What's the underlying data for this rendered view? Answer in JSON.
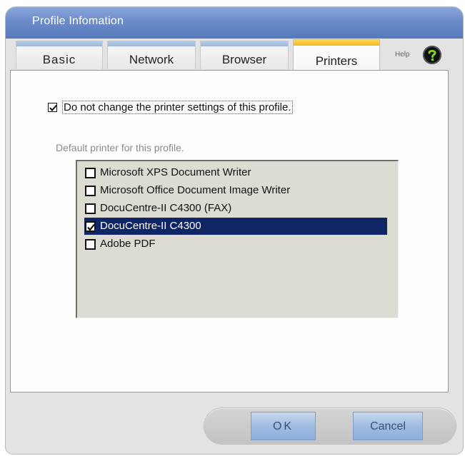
{
  "window": {
    "title": "Profile Infomation"
  },
  "tabs": [
    {
      "label": "Basic",
      "active": false
    },
    {
      "label": "Network",
      "active": false
    },
    {
      "label": "Browser",
      "active": false
    },
    {
      "label": "Printers",
      "active": true
    }
  ],
  "help": {
    "label": "Help",
    "icon": "question-mark-icon"
  },
  "printers": {
    "keep_settings_label": "Do not change the printer settings of this profile.",
    "keep_settings_checked": true,
    "default_label": "Default printer for this profile.",
    "items": [
      {
        "label": "Microsoft XPS Document Writer",
        "checked": false,
        "selected": false
      },
      {
        "label": "Microsoft Office Document Image Writer",
        "checked": false,
        "selected": false
      },
      {
        "label": "DocuCentre-II C4300 (FAX)",
        "checked": false,
        "selected": false
      },
      {
        "label": "DocuCentre-II C4300",
        "checked": true,
        "selected": true
      },
      {
        "label": "Adobe PDF",
        "checked": false,
        "selected": false
      }
    ]
  },
  "footer": {
    "ok_label": "OK",
    "cancel_label": "Cancel"
  },
  "colors": {
    "titlebar": "#6c8bc8",
    "active_tab_accent": "#f2b616",
    "selection": "#0f2566",
    "button": "#9fbbe2"
  }
}
